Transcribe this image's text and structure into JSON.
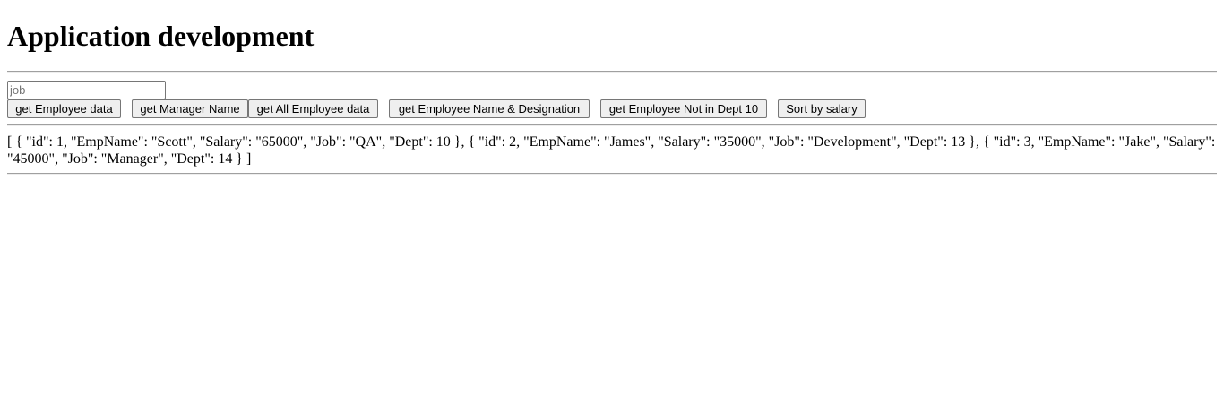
{
  "page": {
    "title": "Application development"
  },
  "form": {
    "job_placeholder": "job",
    "job_value": ""
  },
  "buttons": [
    {
      "label": "get Employee data"
    },
    {
      "label": "get Manager Name"
    },
    {
      "label": "get All Employee data"
    },
    {
      "label": "get Employee Name & Designation"
    },
    {
      "label": "get Employee Not in Dept 10"
    },
    {
      "label": "Sort by salary"
    }
  ],
  "output": {
    "text": "[ { \"id\": 1, \"EmpName\": \"Scott\", \"Salary\": \"65000\", \"Job\": \"QA\", \"Dept\": 10 }, { \"id\": 2, \"EmpName\": \"James\", \"Salary\": \"35000\", \"Job\": \"Development\", \"Dept\": 13 }, { \"id\": 3, \"EmpName\": \"Jake\", \"Salary\": \"45000\", \"Job\": \"Manager\", \"Dept\": 14 } ]"
  }
}
